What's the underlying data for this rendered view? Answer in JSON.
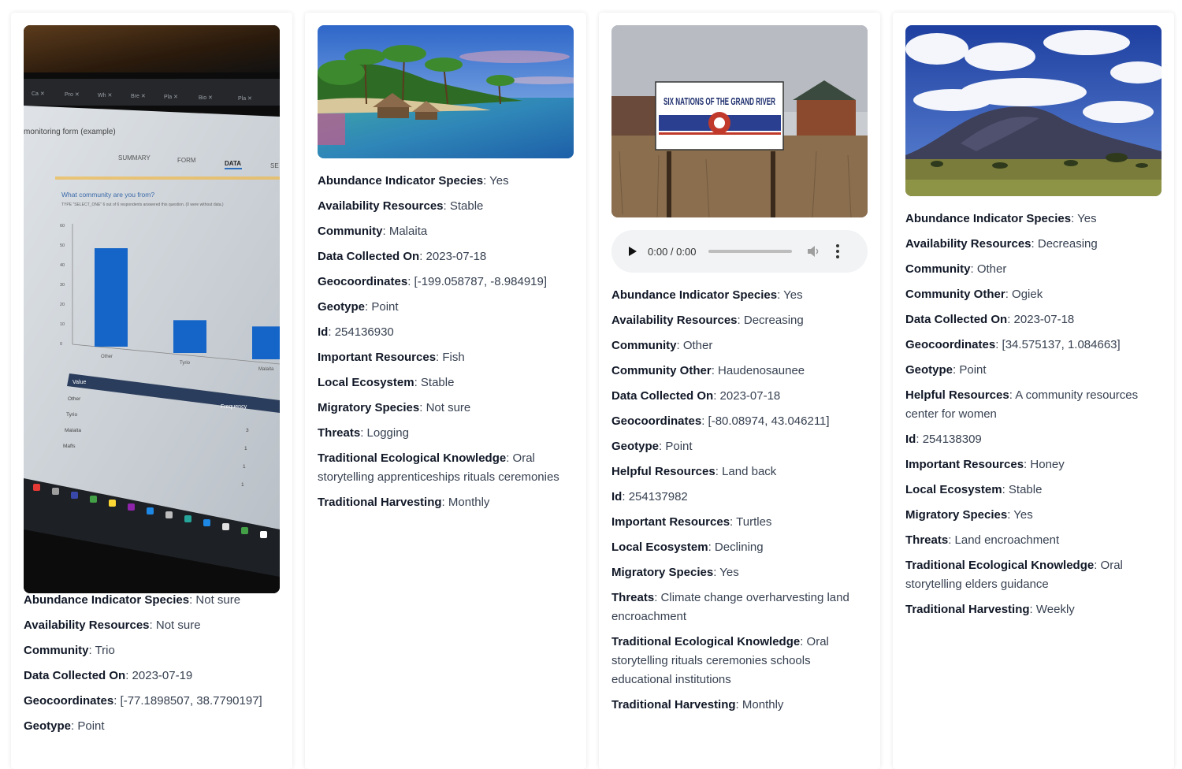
{
  "cards": [
    {
      "image_alt": "Photo of a laptop screen showing a monitoring form bar chart",
      "screen": {
        "page_title": "monitoring form (example)",
        "tabs": [
          "SUMMARY",
          "FORM",
          "DATA",
          "SE"
        ],
        "question": "What community are you from?",
        "question_note": "TYPE \"SELECT_ONE\" 6 out of 6 respondents answered this question. (0 were without data.)",
        "y_ticks": [
          "60",
          "50",
          "40",
          "30",
          "20",
          "10",
          "0"
        ],
        "bars": [
          {
            "label": "Other",
            "value": 3
          },
          {
            "label": "Tyrio",
            "value": 1
          },
          {
            "label": "Malaita",
            "value": 1
          }
        ],
        "table_header": [
          "Value",
          "Frequency"
        ],
        "table_rows": [
          [
            "Other",
            "3"
          ],
          [
            "Tyrio",
            "1"
          ],
          [
            "Malaita",
            "1"
          ],
          [
            "Mafls",
            "1"
          ]
        ]
      },
      "fields": [
        {
          "key": "Abundance Indicator Species",
          "value": "Not sure"
        },
        {
          "key": "Availability Resources",
          "value": "Not sure"
        },
        {
          "key": "Community",
          "value": "Trio"
        },
        {
          "key": "Data Collected On",
          "value": "2023-07-19"
        },
        {
          "key": "Geocoordinates",
          "value": "[-77.1898507, 38.7790197]"
        },
        {
          "key": "Geotype",
          "value": "Point"
        }
      ]
    },
    {
      "image_alt": "Tropical coastline with palm trees and stilt houses",
      "fields": [
        {
          "key": "Abundance Indicator Species",
          "value": "Yes"
        },
        {
          "key": "Availability Resources",
          "value": "Stable"
        },
        {
          "key": "Community",
          "value": "Malaita"
        },
        {
          "key": "Data Collected On",
          "value": "2023-07-18"
        },
        {
          "key": "Geocoordinates",
          "value": "[-199.058787, -8.984919]"
        },
        {
          "key": "Geotype",
          "value": "Point"
        },
        {
          "key": "Id",
          "value": "254136930"
        },
        {
          "key": "Important Resources",
          "value": "Fish"
        },
        {
          "key": "Local Ecosystem",
          "value": "Stable"
        },
        {
          "key": "Migratory Species",
          "value": "Not sure"
        },
        {
          "key": "Threats",
          "value": "Logging"
        },
        {
          "key": "Traditional Ecological Knowledge",
          "value": "Oral storytelling apprenticeships rituals ceremonies"
        },
        {
          "key": "Traditional Harvesting",
          "value": "Monthly"
        }
      ]
    },
    {
      "image_alt": "Six Nations of the Grand River sign in a field",
      "sign_text": "SIX NATIONS OF THE GRAND RIVER",
      "audio": {
        "time": "0:00 / 0:00",
        "progress": 0
      },
      "fields": [
        {
          "key": "Abundance Indicator Species",
          "value": "Yes"
        },
        {
          "key": "Availability Resources",
          "value": "Decreasing"
        },
        {
          "key": "Community",
          "value": "Other"
        },
        {
          "key": "Community Other",
          "value": "Haudenosaunee"
        },
        {
          "key": "Data Collected On",
          "value": "2023-07-18"
        },
        {
          "key": "Geocoordinates",
          "value": "[-80.08974, 43.046211]"
        },
        {
          "key": "Geotype",
          "value": "Point"
        },
        {
          "key": "Helpful Resources",
          "value": "Land back"
        },
        {
          "key": "Id",
          "value": "254137982"
        },
        {
          "key": "Important Resources",
          "value": "Turtles"
        },
        {
          "key": "Local Ecosystem",
          "value": "Declining"
        },
        {
          "key": "Migratory Species",
          "value": "Yes"
        },
        {
          "key": "Threats",
          "value": "Climate change overharvesting land encroachment"
        },
        {
          "key": "Traditional Ecological Knowledge",
          "value": "Oral storytelling rituals ceremonies schools educational institutions"
        },
        {
          "key": "Traditional Harvesting",
          "value": "Monthly"
        }
      ]
    },
    {
      "image_alt": "Mountain under a blue sky with clouds above a savanna",
      "fields": [
        {
          "key": "Abundance Indicator Species",
          "value": "Yes"
        },
        {
          "key": "Availability Resources",
          "value": "Decreasing"
        },
        {
          "key": "Community",
          "value": "Other"
        },
        {
          "key": "Community Other",
          "value": "Ogiek"
        },
        {
          "key": "Data Collected On",
          "value": "2023-07-18"
        },
        {
          "key": "Geocoordinates",
          "value": "[34.575137, 1.084663]"
        },
        {
          "key": "Geotype",
          "value": "Point"
        },
        {
          "key": "Helpful Resources",
          "value": "A community resources center for women"
        },
        {
          "key": "Id",
          "value": "254138309"
        },
        {
          "key": "Important Resources",
          "value": "Honey"
        },
        {
          "key": "Local Ecosystem",
          "value": "Stable"
        },
        {
          "key": "Migratory Species",
          "value": "Yes"
        },
        {
          "key": "Threats",
          "value": "Land encroachment"
        },
        {
          "key": "Traditional Ecological Knowledge",
          "value": "Oral storytelling elders guidance"
        },
        {
          "key": "Traditional Harvesting",
          "value": "Weekly"
        }
      ]
    }
  ]
}
